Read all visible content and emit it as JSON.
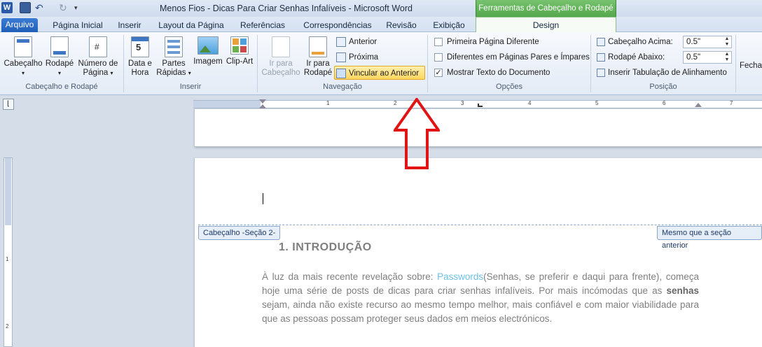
{
  "window": {
    "title": "Menos Fios - Dicas Para Criar Senhas Infalíveis  -  Microsoft Word",
    "contextual_tab_header": "Ferramentas de Cabeçalho e Rodapé"
  },
  "tabs": [
    {
      "label": "Arquivo"
    },
    {
      "label": "Página Inicial"
    },
    {
      "label": "Inserir"
    },
    {
      "label": "Layout da Página"
    },
    {
      "label": "Referências"
    },
    {
      "label": "Correspondências"
    },
    {
      "label": "Revisão"
    },
    {
      "label": "Exibição"
    },
    {
      "label": "Design"
    }
  ],
  "ribbon": {
    "group_header_footer": {
      "label": "Cabeçalho e Rodapé",
      "header": "Cabeçalho",
      "footer": "Rodapé",
      "page_number_1": "Número de",
      "page_number_2": "Página"
    },
    "group_insert": {
      "label": "Inserir",
      "date_1": "Data e",
      "date_2": "Hora",
      "quick_1": "Partes",
      "quick_2": "Rápidas",
      "image": "Imagem",
      "clipart": "Clip-Art"
    },
    "group_nav": {
      "label": "Navegação",
      "goto_header_1": "Ir para",
      "goto_header_2": "Cabeçalho",
      "goto_footer_1": "Ir para",
      "goto_footer_2": "Rodapé",
      "previous": "Anterior",
      "next": "Próxima",
      "link_previous": "Vincular ao Anterior"
    },
    "group_options": {
      "label": "Opções",
      "first_page": "Primeira Página Diferente",
      "odd_even": "Diferentes em Páginas Pares e Ímpares",
      "show_text": "Mostrar Texto do Documento",
      "show_text_checked": true
    },
    "group_position": {
      "label": "Posição",
      "header_top_label": "Cabeçalho Acima:",
      "header_top_value": "0.5\"",
      "footer_bottom_label": "Rodapé Abaixo:",
      "footer_bottom_value": "0.5\"",
      "align_tab": "Inserir Tabulação de Alinhamento"
    },
    "close_partial": "Fecha"
  },
  "ruler": {
    "numbers": [
      "1",
      "2",
      "3",
      "4",
      "5",
      "6",
      "7"
    ],
    "left_numbers": [
      "1",
      "2"
    ]
  },
  "document": {
    "header_tag_left": "Cabeçalho -Seção 2-",
    "header_tag_right": "Mesmo que a seção anterior",
    "heading": "1.  INTRODUÇÃO",
    "para_1": "À luz da mais recente revelação sobre: ",
    "para_link": "Passwords",
    "para_2": "(Senhas, se preferir e daqui para frente), começa hoje uma série de posts de dicas para criar senhas infalíveis. Por mais incómodas que as ",
    "para_bold": "senhas",
    "para_3": " sejam, ainda não existe recurso ao mesmo tempo melhor, mais confiável e com maior viabilidade para que as pessoas possam proteger seus dados em meios electrónicos."
  }
}
